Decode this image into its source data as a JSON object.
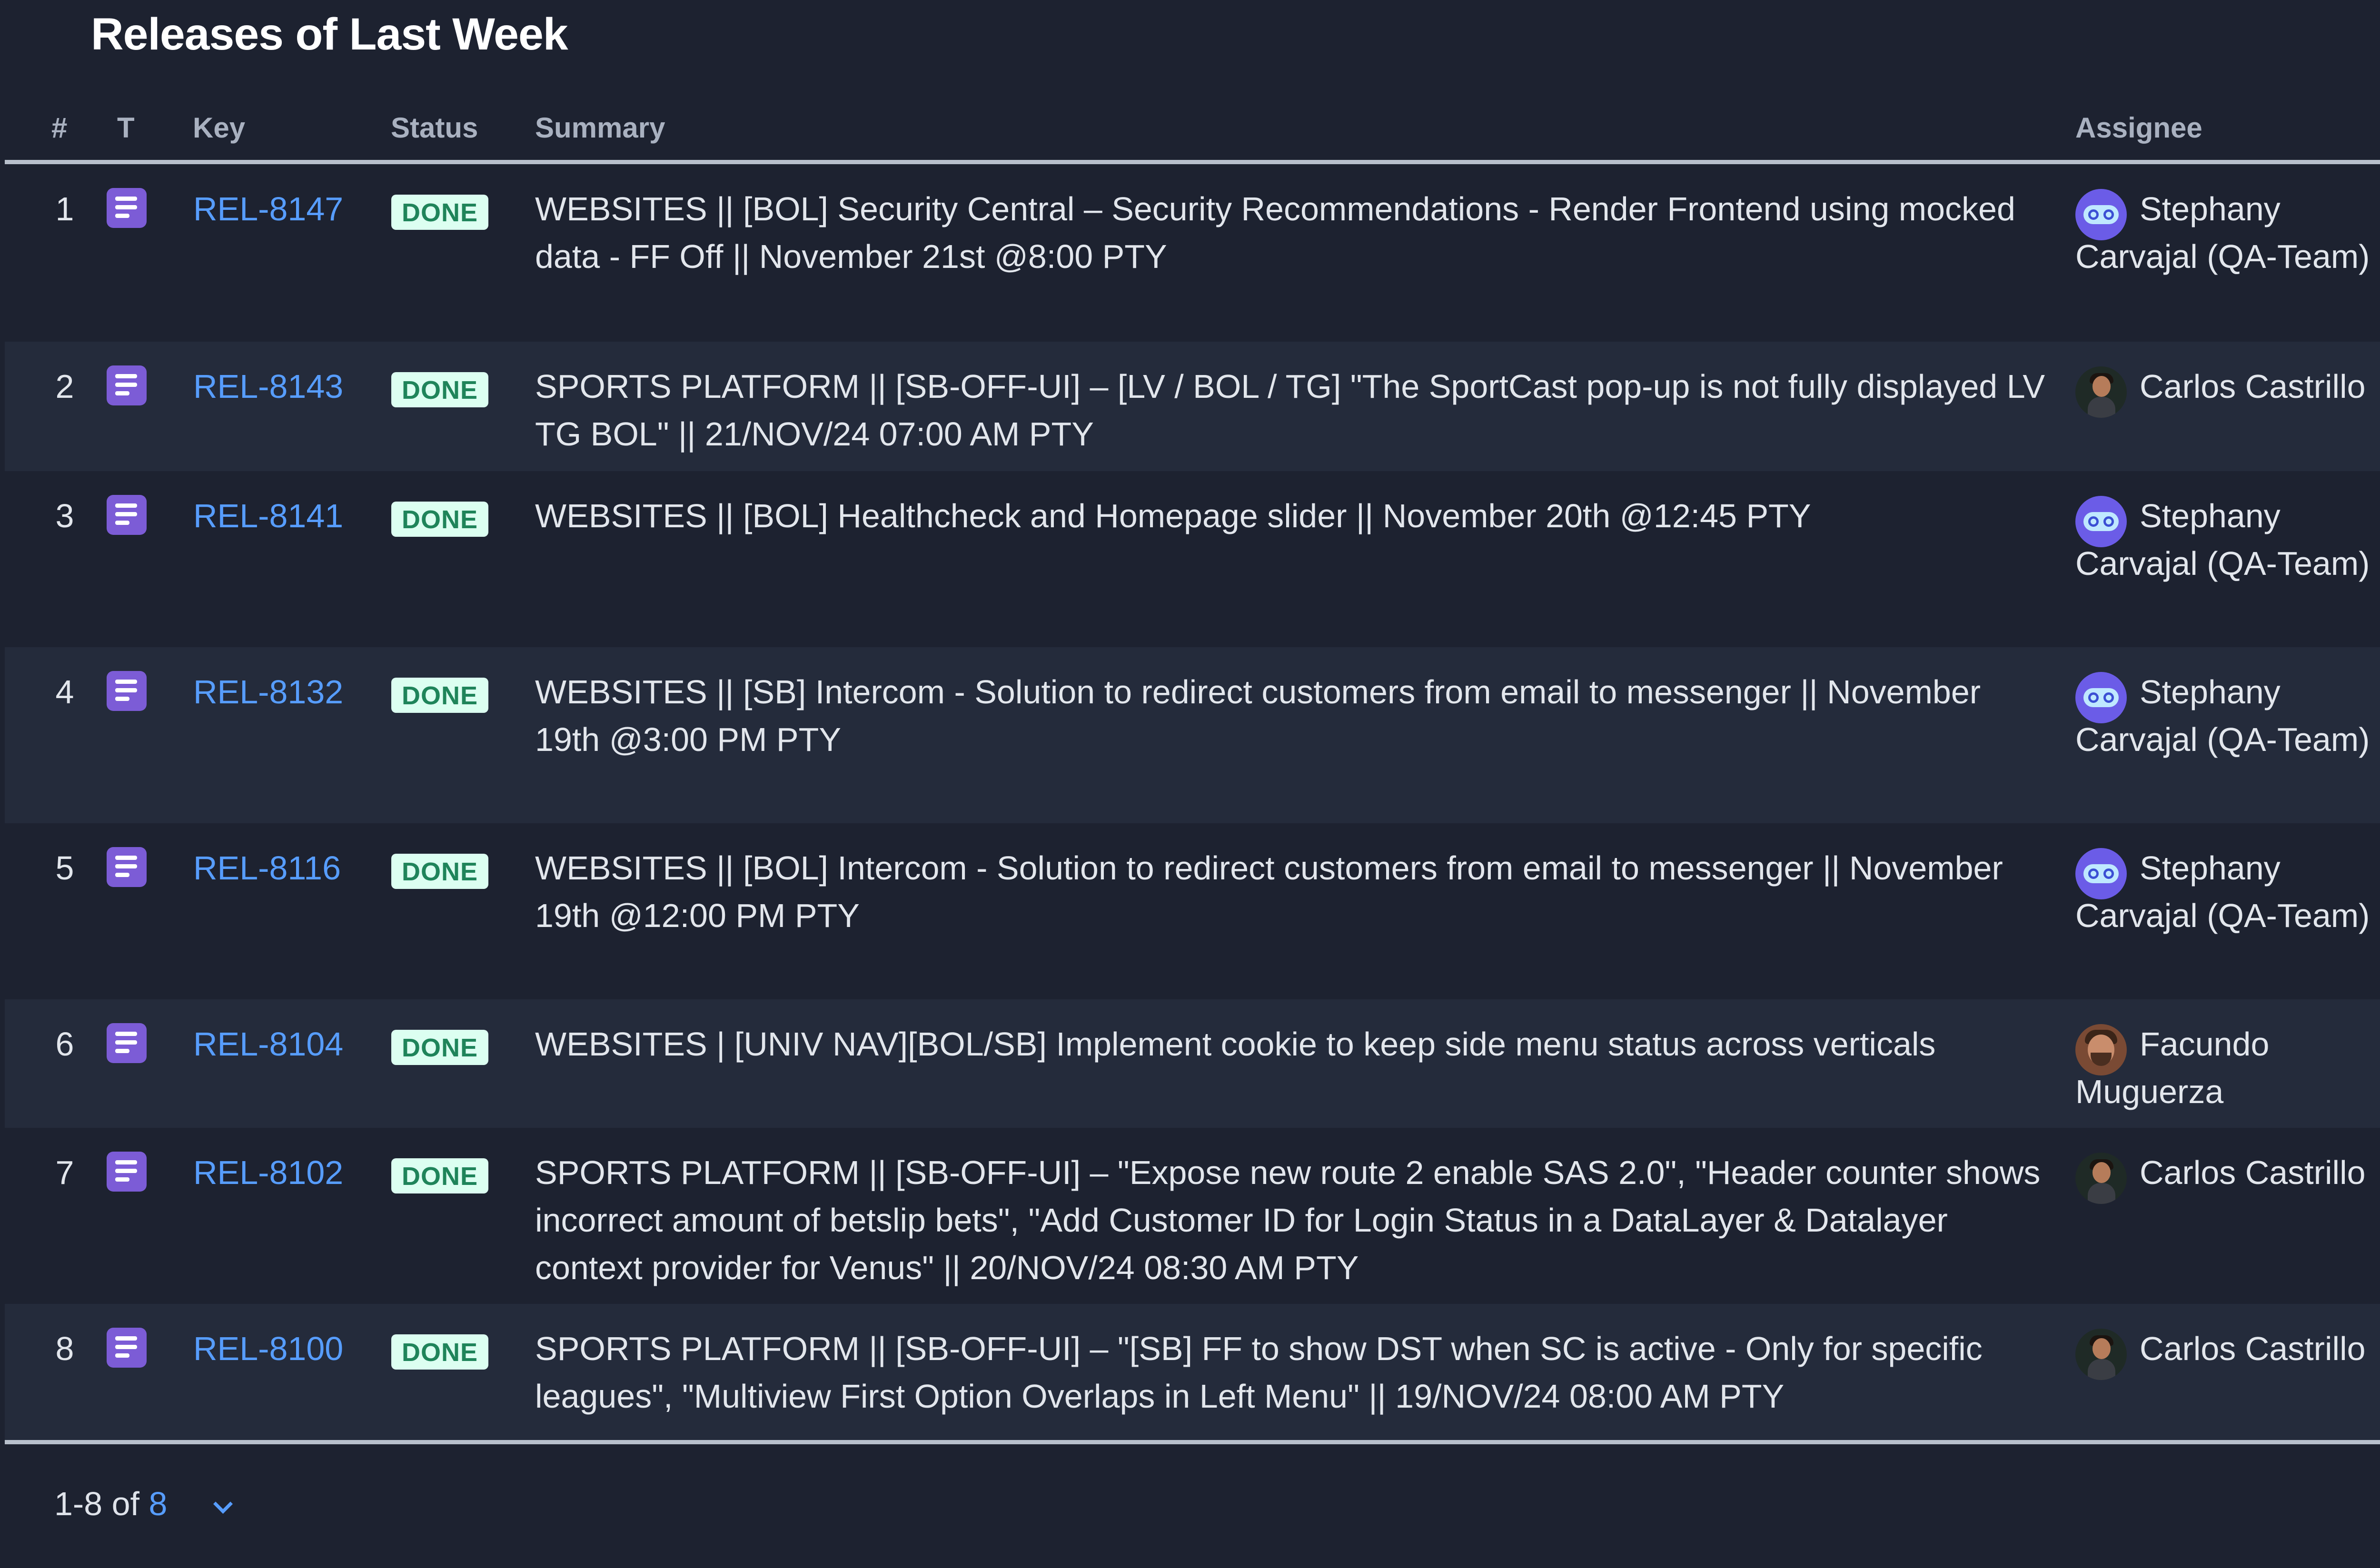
{
  "title": "Releases of Last Week",
  "columns": {
    "num": "#",
    "type": "T",
    "key": "Key",
    "status": "Status",
    "summary": "Summary",
    "assignee": "Assignee"
  },
  "rows": [
    {
      "num": "1",
      "key": "REL-8147",
      "status": "DONE",
      "summary": "WEBSITES || [BOL] Security Central – Security Recommendations - Render Frontend using mocked data - FF Off || November 21st @8:00 PTY",
      "assignee": "Stephany Carvajal (QA-Team)",
      "avatar": "robot-avatar"
    },
    {
      "num": "2",
      "key": "REL-8143",
      "status": "DONE",
      "summary": "SPORTS PLATFORM || [SB-OFF-UI] – [LV / BOL / TG] \"The SportCast pop-up is not fully displayed LV TG BOL\" || 21/NOV/24 07:00 AM PTY",
      "assignee": "Carlos Castrillo",
      "avatar": "photo-avatar"
    },
    {
      "num": "3",
      "key": "REL-8141",
      "status": "DONE",
      "summary": "WEBSITES || [BOL] Healthcheck and Homepage slider || November 20th @12:45 PTY",
      "assignee": "Stephany Carvajal (QA-Team)",
      "avatar": "robot-avatar"
    },
    {
      "num": "4",
      "key": "REL-8132",
      "status": "DONE",
      "summary": "WEBSITES || [SB] Intercom - Solution to redirect customers from email to messenger || November 19th @3:00 PM PTY",
      "assignee": "Stephany Carvajal (QA-Team)",
      "avatar": "robot-avatar"
    },
    {
      "num": "5",
      "key": "REL-8116",
      "status": "DONE",
      "summary": "WEBSITES || [BOL] Intercom - Solution to redirect customers from email to messenger || November 19th @12:00 PM PTY",
      "assignee": "Stephany Carvajal (QA-Team)",
      "avatar": "robot-avatar"
    },
    {
      "num": "6",
      "key": "REL-8104",
      "status": "DONE",
      "summary": "WEBSITES | [UNIV NAV][BOL/SB] Implement cookie to keep side menu status across verticals",
      "assignee": "Facundo Muguerza",
      "avatar": "photo-avatar"
    },
    {
      "num": "7",
      "key": "REL-8102",
      "status": "DONE",
      "summary": "SPORTS PLATFORM || [SB-OFF-UI] – \"Expose new route 2 enable SAS 2.0\", \"Header counter shows incorrect amount of betslip bets\", \"Add Customer ID for Login Status in a DataLayer & Datalayer context provider for Venus\" || 20/NOV/24 08:30 AM PTY",
      "assignee": "Carlos Castrillo",
      "avatar": "photo-avatar"
    },
    {
      "num": "8",
      "key": "REL-8100",
      "status": "DONE",
      "summary": "SPORTS PLATFORM || [SB-OFF-UI] – \"[SB] FF to show DST when SC is active - Only for specific leagues\", \"Multiview First Option Overlaps in Left Menu\" || 19/NOV/24 08:00 AM PTY",
      "assignee": "Carlos Castrillo",
      "avatar": "photo-avatar"
    }
  ],
  "footer": {
    "range": "1-8 of ",
    "total": "8"
  },
  "colors": {
    "background": "#1d2230",
    "row_alt": "#242b3b",
    "link": "#579dff",
    "badge_bg": "#dcfff1",
    "badge_text": "#1f845a",
    "type_icon": "#7c5cd6"
  },
  "icons": {
    "type": "story-icon",
    "pager": "chevron-down-icon"
  }
}
